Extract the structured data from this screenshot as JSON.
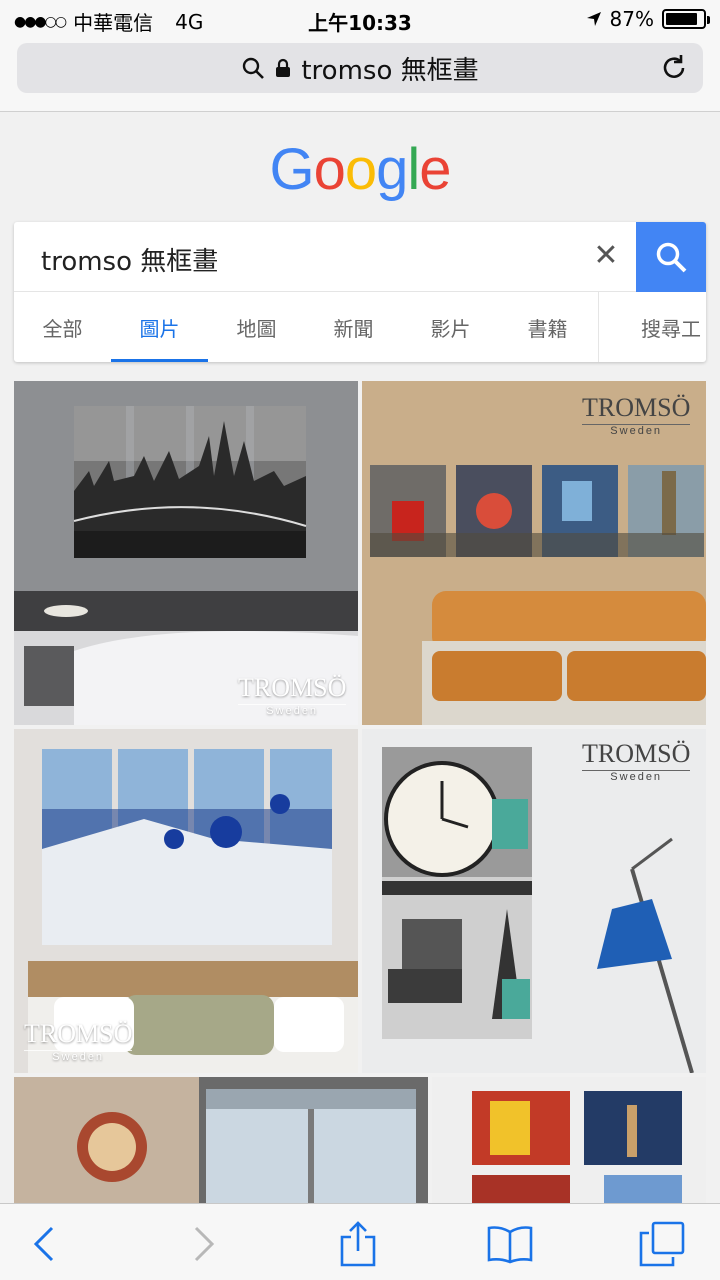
{
  "status": {
    "carrier": "中華電信",
    "network": "4G",
    "time": "上午10:33",
    "battery_text": "87%",
    "battery_level": 0.87
  },
  "browser": {
    "url_text": "tromso 無框畫",
    "icons": [
      "search-icon",
      "lock-icon",
      "reload-icon"
    ]
  },
  "google": {
    "logo": [
      "G",
      "o",
      "o",
      "g",
      "l",
      "e"
    ]
  },
  "search": {
    "query": "tromso 無框畫",
    "clear_symbol": "✕"
  },
  "tabs": [
    {
      "label": "全部"
    },
    {
      "label": "圖片",
      "active": true
    },
    {
      "label": "地圖"
    },
    {
      "label": "新聞"
    },
    {
      "label": "影片"
    },
    {
      "label": "書籍"
    },
    {
      "label": "搜尋工"
    }
  ],
  "images": [
    {
      "brand": "TROMSÖ",
      "brand_sub": "Sweden"
    },
    {
      "brand": "TROMSÖ",
      "brand_sub": "Sweden"
    },
    {
      "brand": "TROMSÖ",
      "brand_sub": "Sweden"
    },
    {
      "brand": "TROMSÖ",
      "brand_sub": "Sweden"
    }
  ],
  "toolbar": {
    "icons": [
      "back-icon",
      "forward-icon",
      "share-icon",
      "bookmarks-icon",
      "tabs-icon"
    ]
  },
  "colors": {
    "google_blue": "#4285f4",
    "link_blue": "#1a73e8"
  }
}
